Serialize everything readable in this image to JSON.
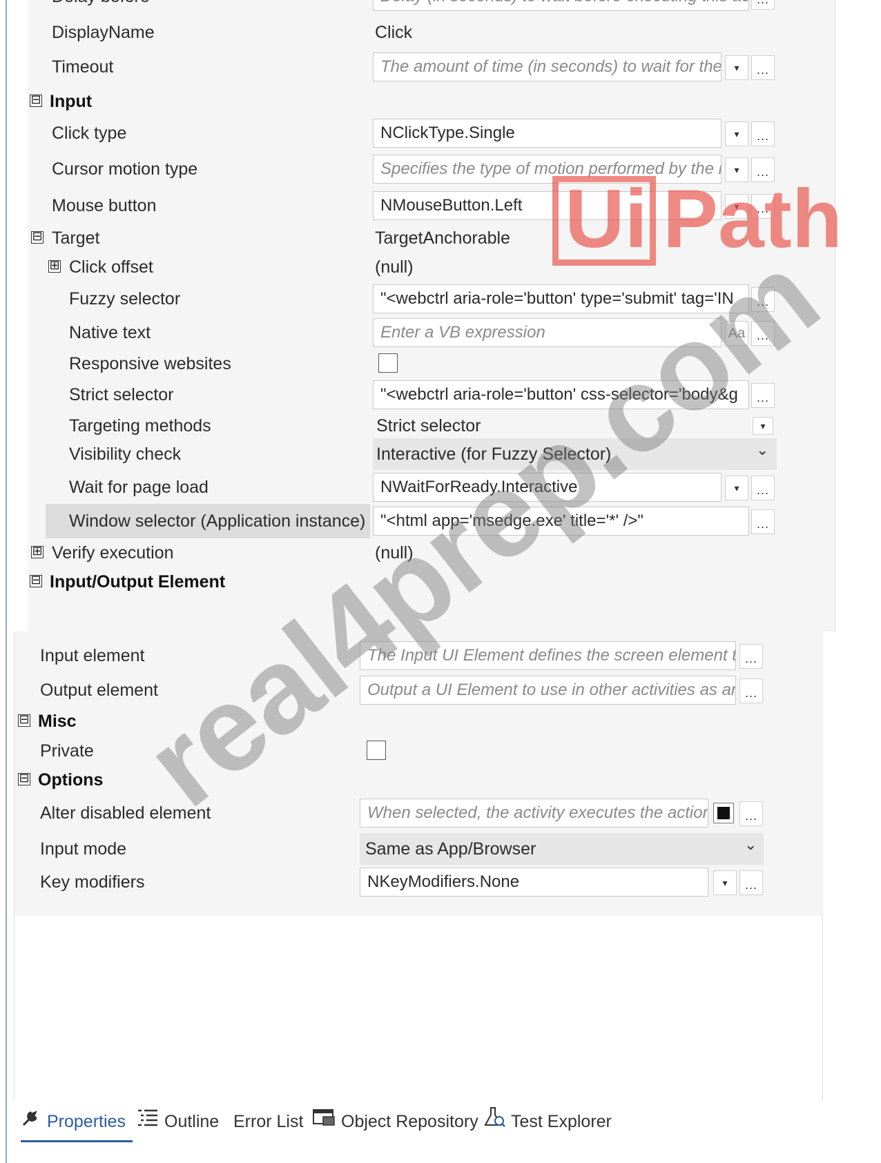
{
  "top_section": {
    "cut_off_row": {
      "name": "Delay before",
      "value": "Delay (in seconds) to wait before executing this acti"
    },
    "display_name": {
      "name": "DisplayName",
      "value": "Click"
    },
    "timeout": {
      "name": "Timeout",
      "placeholder": "The amount of time (in seconds) to wait for the a"
    },
    "input_category": {
      "name": "Input"
    },
    "click_type": {
      "name": "Click type",
      "value": "NClickType.Single"
    },
    "cursor_motion_type": {
      "name": "Cursor motion type",
      "placeholder": "Specifies the type of motion performed by the m"
    },
    "mouse_button": {
      "name": "Mouse button",
      "value": "NMouseButton.Left"
    },
    "target": {
      "name": "Target",
      "value": "TargetAnchorable"
    },
    "click_offset": {
      "name": "Click offset",
      "value": "(null)"
    },
    "fuzzy_selector": {
      "name": "Fuzzy selector",
      "value": "\"<webctrl aria-role='button' type='submit' tag='IN"
    },
    "native_text": {
      "name": "Native text",
      "placeholder": "Enter a VB expression"
    },
    "responsive_websites": {
      "name": "Responsive websites"
    },
    "strict_selector": {
      "name": "Strict selector",
      "value": "\"<webctrl aria-role='button' css-selector='body&g"
    },
    "targeting_methods": {
      "name": "Targeting methods",
      "value": "Strict selector"
    },
    "visibility_check": {
      "name": "Visibility check",
      "value": "Interactive (for Fuzzy Selector)"
    },
    "wait_for_page_load": {
      "name": "Wait for page load",
      "value": "NWaitForReady.Interactive"
    },
    "window_selector": {
      "name": "Window selector (Application instance)",
      "value": "\"<html app='msedge.exe' title='*' />\""
    },
    "verify_execution": {
      "name": "Verify execution",
      "value": "(null)"
    },
    "io_category": {
      "name": "Input/Output Element"
    }
  },
  "bottom_section": {
    "input_element": {
      "name": "Input element",
      "placeholder": "The Input UI Element defines the screen element tha"
    },
    "output_element": {
      "name": "Output element",
      "placeholder": "Output a UI Element to use in other activities as an i"
    },
    "misc_category": {
      "name": "Misc"
    },
    "private": {
      "name": "Private"
    },
    "options_category": {
      "name": "Options"
    },
    "alter_disabled_element": {
      "name": "Alter disabled element",
      "placeholder": "When selected, the activity executes the action e"
    },
    "input_mode": {
      "name": "Input mode",
      "value": "Same as App/Browser"
    },
    "key_modifiers": {
      "name": "Key modifiers",
      "value": "NKeyModifiers.None"
    }
  },
  "glyphs": {
    "expand": "⊞",
    "collapse": "⊟",
    "dropdown": "▾",
    "chevron": "⌄",
    "ellipsis": "...",
    "font_icon": "Aa"
  },
  "tabs": [
    {
      "label": "Properties",
      "icon": "wrench-icon",
      "active": true
    },
    {
      "label": "Outline",
      "icon": "outline-list-icon",
      "active": false
    },
    {
      "label": "Error List",
      "icon": "",
      "active": false
    },
    {
      "label": "Object Repository",
      "icon": "object-repository-icon",
      "active": false
    },
    {
      "label": "Test Explorer",
      "icon": "flask-icon",
      "active": false
    }
  ],
  "watermark": {
    "text": "real4prep.com",
    "logo_left": "Ui",
    "logo_right": "Path"
  },
  "colors": {
    "accent": "#2a5c9e",
    "panel_bg": "#f5f5f5",
    "watermark_red": "#e85a50"
  }
}
